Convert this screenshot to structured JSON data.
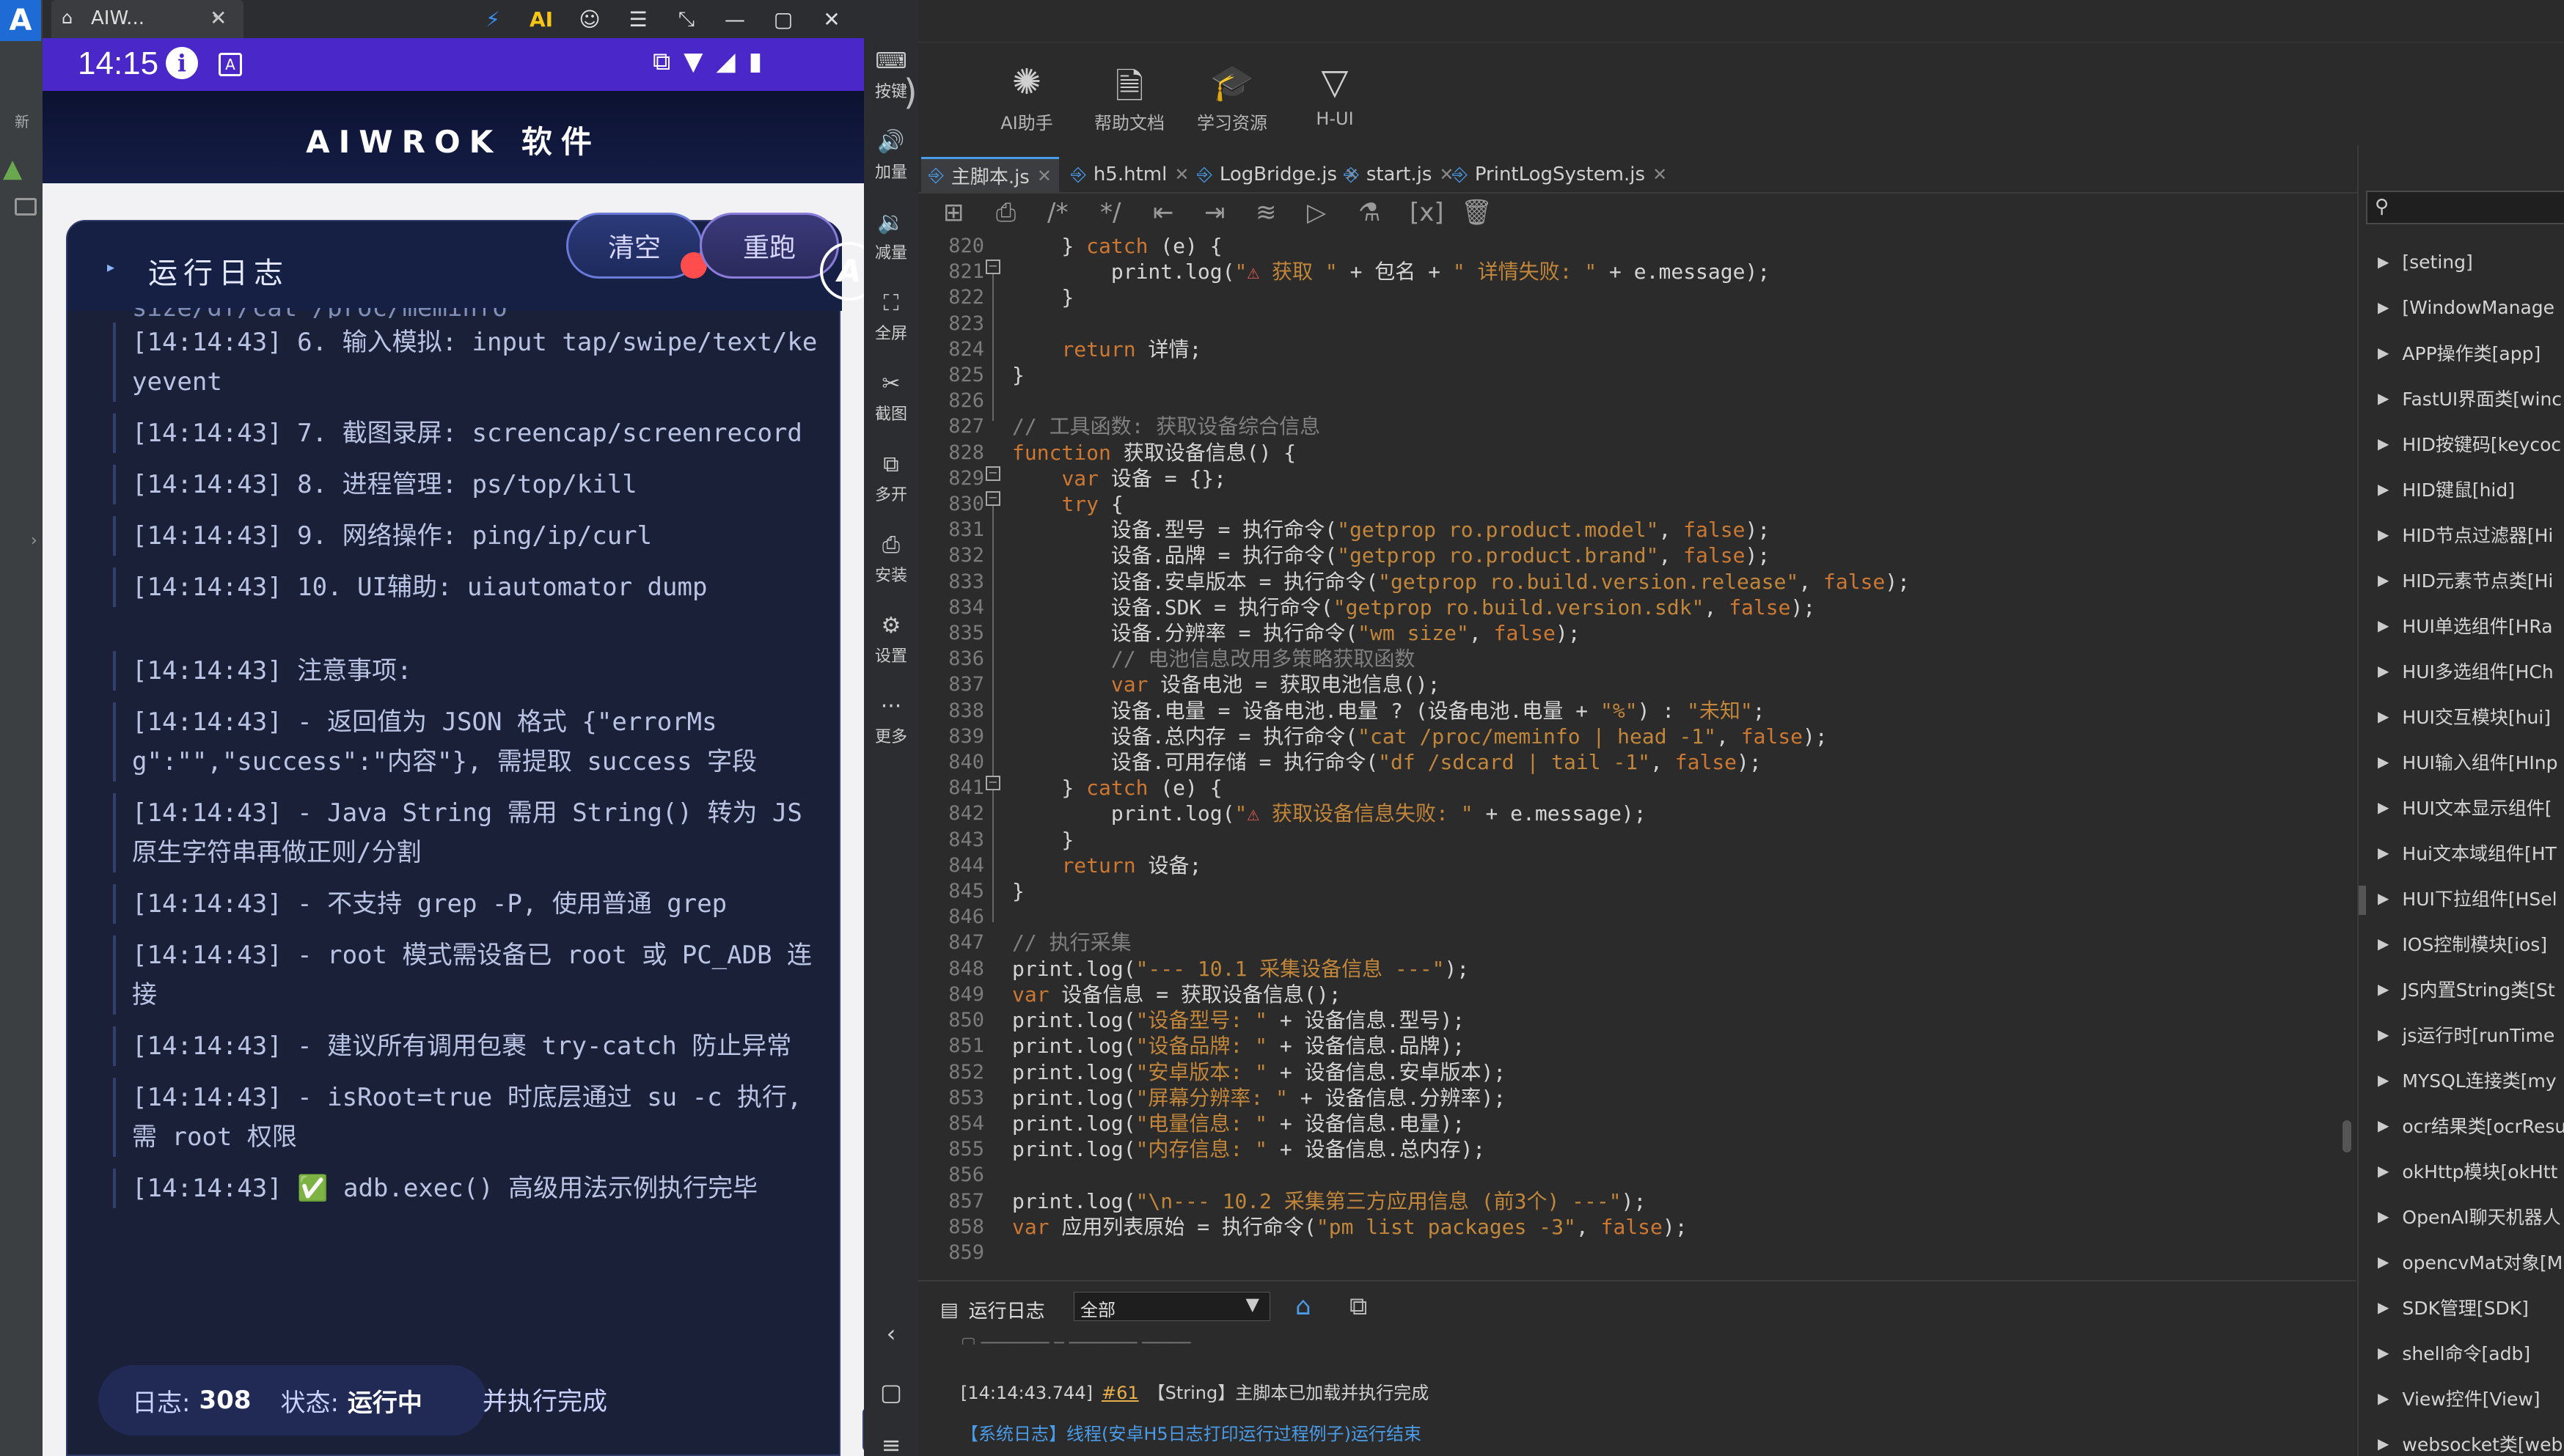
{
  "leftstrip": {
    "logo": "A",
    "label": "新"
  },
  "window": {
    "tab_title": "AIW...",
    "tab_close": "✕",
    "tools": [
      "⚡",
      "AI",
      "☺",
      "☰",
      "⤡",
      "—",
      "▢",
      "✕",
      "«"
    ]
  },
  "phone": {
    "time": "14:15",
    "app_title": "AIWROK 软件",
    "log_title": "运行日志",
    "btn_clear": "清空",
    "btn_rerun": "重跑",
    "cut_line": "size/df/cat /proc/meminfo",
    "log_lines": [
      "[14:14:43] 6. 输入模拟: input tap/swipe/text/keyevent",
      "[14:14:43] 7. 截图录屏: screencap/screenrecord",
      "[14:14:43] 8. 进程管理: ps/top/kill",
      "[14:14:43] 9. 网络操作: ping/ip/curl",
      "[14:14:43] 10. UI辅助: uiautomator dump",
      "[14:14:43] 注意事项:",
      "[14:14:43] - 返回值为 JSON 格式 {\"errorMsg\":\"\",\"success\":\"内容\"}, 需提取 success 字段",
      "[14:14:43] - Java String 需用 String() 转为 JS 原生字符串再做正则/分割",
      "[14:14:43] - 不支持 grep -P, 使用普通 grep",
      "[14:14:43] - root 模式需设备已 root 或 PC_ADB 连接",
      "[14:14:43] - 建议所有调用包裹 try-catch 防止异常",
      "[14:14:43] - isRoot=true 时底层通过 su -c 执行, 需 root 权限",
      "[14:14:43] ✅ adb.exec() 高级用法示例执行完毕"
    ],
    "footer": {
      "log_label": "日志:",
      "log_count": "308",
      "state_label": "状态:",
      "state_value": "运行中",
      "trailing": "并执行完成"
    }
  },
  "vtool": [
    {
      "icon": "⌨",
      "label": "按键"
    },
    {
      "icon": "🔊",
      "label": "加量"
    },
    {
      "icon": "🔉",
      "label": "减量"
    },
    {
      "icon": "⛶",
      "label": "全屏"
    },
    {
      "icon": "✂",
      "label": "截图"
    },
    {
      "icon": "⧉",
      "label": "多开"
    },
    {
      "icon": "⎙",
      "label": "安装"
    },
    {
      "icon": "⚙",
      "label": "设置"
    },
    {
      "icon": "···",
      "label": "更多"
    }
  ],
  "ide": {
    "toolbar": [
      {
        "icon": "✺",
        "label": "AI助手"
      },
      {
        "icon": "🗎",
        "label": "帮助文档"
      },
      {
        "icon": "🎓",
        "label": "学习资源"
      },
      {
        "icon": "▽",
        "label": "H-UI"
      }
    ],
    "tabs": [
      "主脚本.js",
      "h5.html",
      "LogBridge.js",
      "start.js",
      "PrintLogSystem.js"
    ],
    "line_numbers": [
      "820",
      "821",
      "822",
      "823",
      "824",
      "825",
      "826",
      "827",
      "828",
      "829",
      "830",
      "831",
      "832",
      "833",
      "834",
      "835",
      "836",
      "837",
      "838",
      "839",
      "840",
      "841",
      "842",
      "843",
      "844",
      "845",
      "846",
      "847",
      "848",
      "849",
      "850",
      "851",
      "852",
      "853",
      "854",
      "855",
      "856",
      "857",
      "858",
      "859"
    ],
    "log_panel": {
      "label": "运行日志",
      "filter": "全部",
      "line1_time": "[14:14:43.744]",
      "line1_link": "#61",
      "line1_text": "【String】主脚本已加载并执行完成",
      "line2": "【系统日志】线程(安卓H5日志打印运行过程例子)运行结束"
    },
    "right_list": [
      "[seting]",
      "[WindowManage",
      "APP操作类[app]",
      "FastUI界面类[winc",
      "HID按键码[keycoc",
      "HID键鼠[hid]",
      "HID节点过滤器[Hi",
      "HID元素节点类[Hi",
      "HUI单选组件[HRa",
      "HUI多选组件[HCh",
      "HUI交互模块[hui]",
      "HUI输入组件[HInp",
      "HUI文本显示组件[",
      "Hui文本域组件[HT",
      "HUI下拉组件[HSel",
      "IOS控制模块[ios]",
      "JS内置String类[St",
      "js运行时[runTime",
      "MYSQL连接类[my",
      "ocr结果类[ocrResu",
      "okHttp模块[okHtt",
      "OpenAI聊天机器人",
      "opencvMat对象[M",
      "SDK管理[SDK]",
      "shell命令[adb]",
      "View控件[View]",
      "websocket类[web"
    ]
  }
}
